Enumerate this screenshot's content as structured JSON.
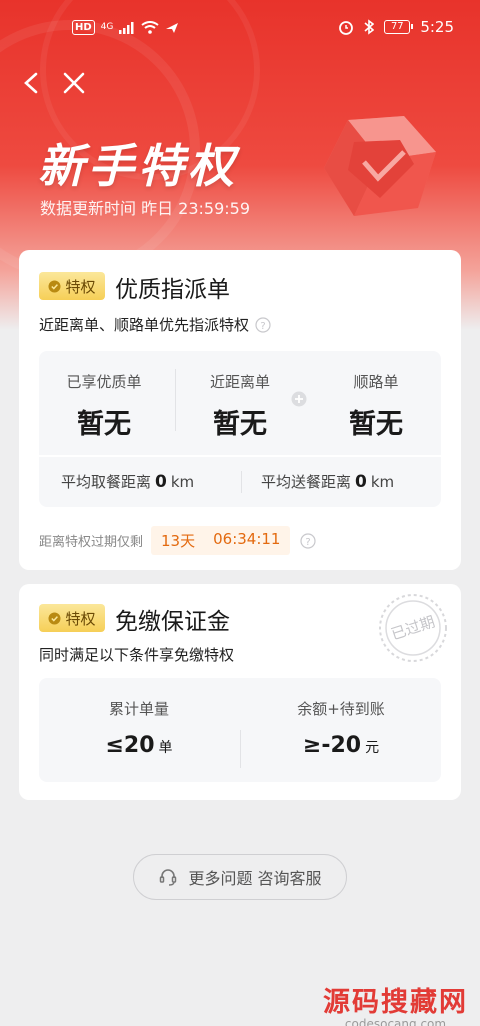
{
  "status_bar": {
    "hd": "HD",
    "network": "4G",
    "battery": "77",
    "time": "5:25"
  },
  "header": {
    "title": "新手特权",
    "update_time": "数据更新时间 昨日 23:59:59"
  },
  "privilege1": {
    "badge": "特权",
    "title": "优质指派单",
    "desc": "近距离单、顺路单优先指派特权",
    "stats": [
      {
        "label": "已享优质单",
        "value": "暂无"
      },
      {
        "label": "近距离单",
        "value": "暂无"
      },
      {
        "label": "顺路单",
        "value": "暂无"
      }
    ],
    "pickup_label": "平均取餐距离",
    "pickup_value": "0",
    "pickup_unit": "km",
    "delivery_label": "平均送餐距离",
    "delivery_value": "0",
    "delivery_unit": "km",
    "expire_label": "距离特权过期仅剩",
    "expire_days": "13天",
    "expire_time": "06:34:11"
  },
  "privilege2": {
    "badge": "特权",
    "title": "免缴保证金",
    "desc": "同时满足以下条件享免缴特权",
    "stamp": "已过期",
    "requirements": [
      {
        "label": "累计单量",
        "value": "≤20",
        "unit": "单"
      },
      {
        "label": "余额+待到账",
        "value": "≥-20",
        "unit": "元"
      }
    ]
  },
  "service_button": "更多问题 咨询客服",
  "watermark": {
    "main": "源码搜藏网",
    "sub": "codesocang.com"
  },
  "colors": {
    "brand_red": "#e8332b",
    "badge_gold": "#f6cf57",
    "countdown_orange": "#e36a10"
  },
  "icons": [
    "back-icon",
    "close-icon",
    "gem-shield-icon",
    "badge-shield-icon",
    "help-icon",
    "plus-icon",
    "headset-icon",
    "expired-stamp-icon"
  ]
}
